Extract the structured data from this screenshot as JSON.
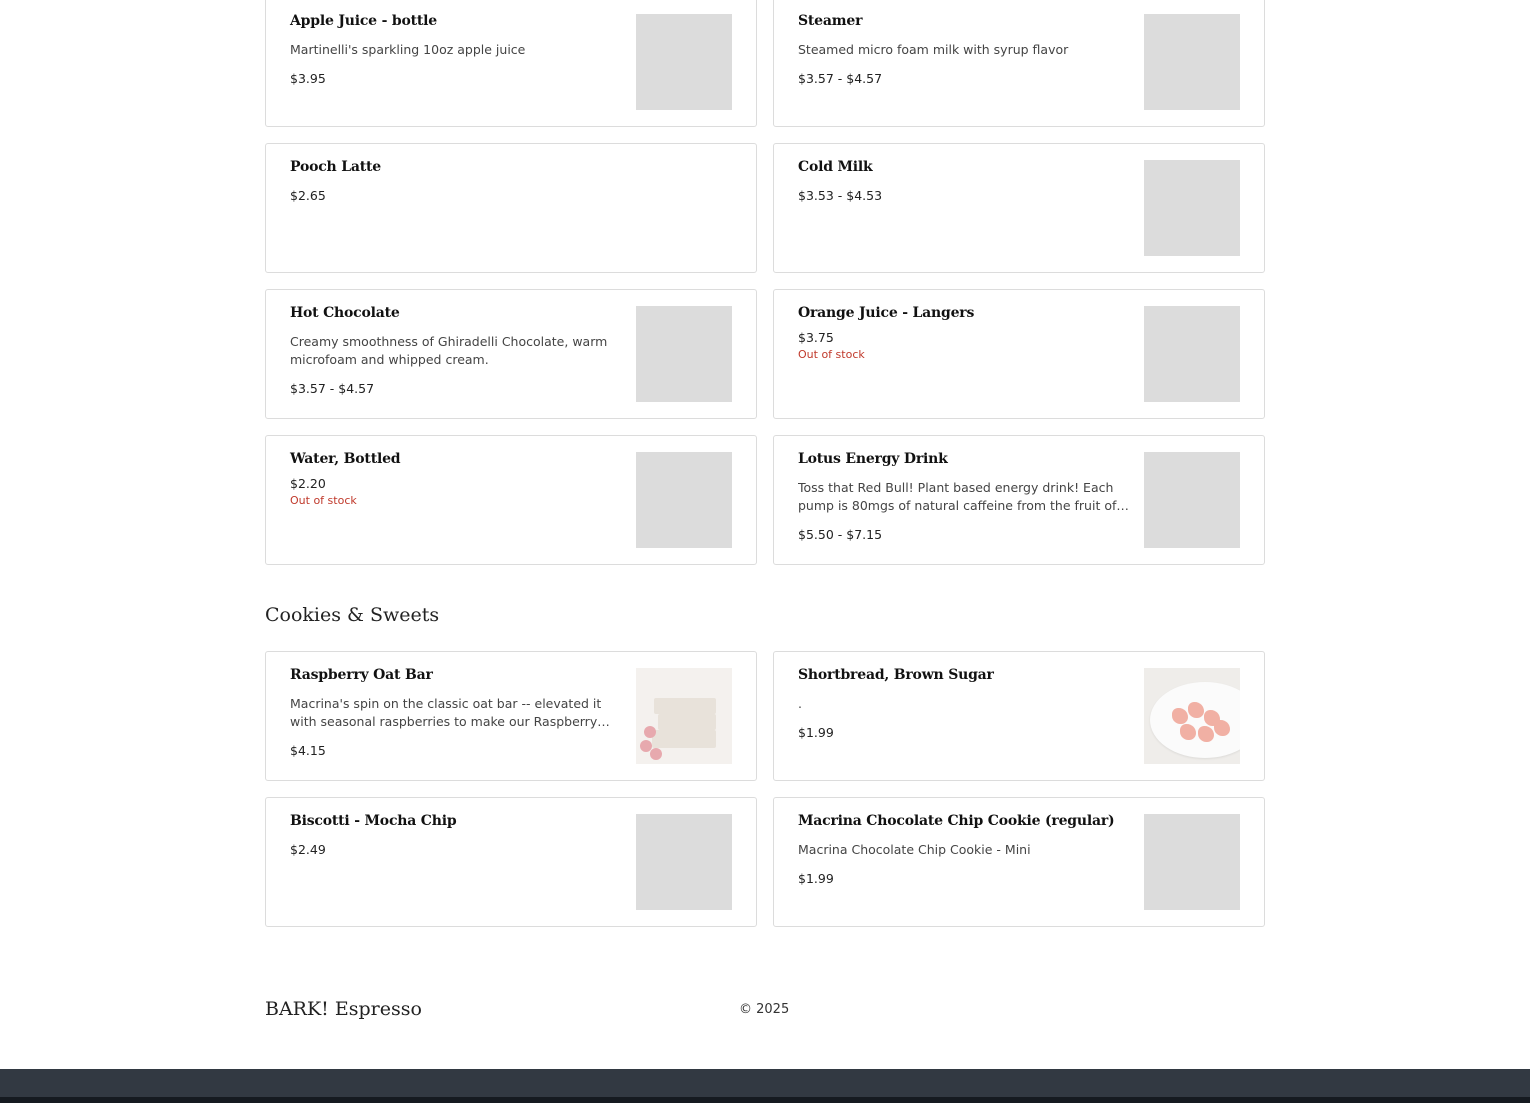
{
  "sections": [
    {
      "title": "",
      "items": [
        {
          "name": "Apple Juice - bottle",
          "description": "Martinelli's sparkling 10oz apple juice",
          "price": "$3.95",
          "stock": "",
          "thumb": "placeholder"
        },
        {
          "name": "Steamer",
          "description": "Steamed micro foam milk with syrup flavor",
          "price": "$3.57 - $4.57",
          "stock": "",
          "thumb": "placeholder"
        },
        {
          "name": "Pooch Latte",
          "description": "",
          "price": "$2.65",
          "stock": "",
          "thumb": "none"
        },
        {
          "name": "Cold Milk",
          "description": "",
          "price": "$3.53 - $4.53",
          "stock": "",
          "thumb": "placeholder"
        },
        {
          "name": "Hot Chocolate",
          "description": "Creamy smoothness of Ghiradelli Chocolate, warm microfoam and whipped cream.",
          "price": "$3.57 - $4.57",
          "stock": "",
          "thumb": "placeholder"
        },
        {
          "name": "Orange Juice - Langers",
          "description": "",
          "price": "$3.75",
          "stock": "Out of stock",
          "thumb": "placeholder"
        },
        {
          "name": "Water, Bottled",
          "description": "",
          "price": "$2.20",
          "stock": "Out of stock",
          "thumb": "placeholder"
        },
        {
          "name": "Lotus Energy Drink",
          "description": "Toss that Red Bull! Plant based energy drink! Each pump is 80mgs of natural caffeine from the fruit of the coffee plant.",
          "price": "$5.50 - $7.15",
          "stock": "",
          "thumb": "placeholder"
        }
      ]
    },
    {
      "title": "Cookies & Sweets",
      "items": [
        {
          "name": "Raspberry Oat Bar",
          "description": "Macrina's spin on the classic oat bar -- elevated it with seasonal raspberries to make our Raspberry Oat Bar!",
          "price": "$4.15",
          "stock": "",
          "thumb": "photo-oat"
        },
        {
          "name": "Shortbread, Brown Sugar",
          "description": ".",
          "price": "$1.99",
          "stock": "",
          "thumb": "photo-shortbread"
        },
        {
          "name": "Biscotti - Mocha Chip",
          "description": "",
          "price": "$2.49",
          "stock": "",
          "thumb": "placeholder"
        },
        {
          "name": "Macrina Chocolate Chip Cookie (regular)",
          "description": "Macrina Chocolate Chip Cookie - Mini",
          "price": "$1.99",
          "stock": "",
          "thumb": "placeholder"
        }
      ]
    }
  ],
  "footer": {
    "brand": "BARK! Espresso",
    "copyright": "© 2025"
  },
  "colors": {
    "out_of_stock": "#c0392b",
    "placeholder": "#dcdcdc",
    "bottom_bar": "#323942"
  }
}
